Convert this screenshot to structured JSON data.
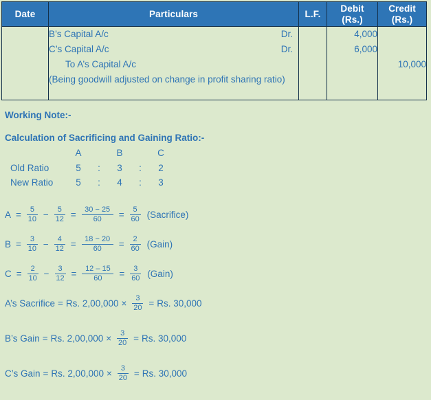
{
  "colors": {
    "page_background": "#dce9cd",
    "header_fill": "#2e75b6",
    "header_text": "#ffffff",
    "body_text": "#2e74b5",
    "border": "#13304a"
  },
  "journal": {
    "headers": {
      "date": "Date",
      "particulars": "Particulars",
      "lf": "L.F.",
      "debit_line1": "Debit",
      "debit_line2": "(Rs.)",
      "credit_line1": "Credit",
      "credit_line2": "(Rs.)"
    },
    "entry": {
      "date": "",
      "lf": "",
      "lines": [
        {
          "particulars": "B’s Capital A/c",
          "dr_tag": "Dr.",
          "debit": "4,000",
          "credit": ""
        },
        {
          "particulars": "C’s Capital A/c",
          "dr_tag": "Dr.",
          "debit": "6,000",
          "credit": ""
        },
        {
          "particulars": "To A’s Capital A/c",
          "dr_tag": "",
          "debit": "",
          "credit": "10,000"
        }
      ],
      "narration": "(Being goodwill adjusted on change in profit sharing ratio)"
    }
  },
  "working_note": {
    "title": "Working Note:-",
    "calc_title": "Calculation of Sacrificing and Gaining Ratio:-",
    "ratio_table": {
      "partner_headers": [
        "A",
        "B",
        "C"
      ],
      "separator": ":",
      "rows": [
        {
          "label": "Old Ratio",
          "values": [
            "5",
            "3",
            "2"
          ]
        },
        {
          "label": "New Ratio",
          "values": [
            "5",
            "4",
            "3"
          ]
        }
      ]
    },
    "fraction_equations": [
      {
        "partner": "A",
        "eq_sign": "=",
        "f1": {
          "num": "5",
          "den": "10"
        },
        "minus": "−",
        "f2": {
          "num": "5",
          "den": "12"
        },
        "eq2": "=",
        "f3": {
          "num": "30 − 25",
          "den": "60"
        },
        "eq3": "=",
        "f4": {
          "num": "5",
          "den": "60"
        },
        "result_label": "(Sacrifice)"
      },
      {
        "partner": "B",
        "eq_sign": "=",
        "f1": {
          "num": "3",
          "den": "10"
        },
        "minus": "−",
        "f2": {
          "num": "4",
          "den": "12"
        },
        "eq2": "=",
        "f3": {
          "num": "18 − 20",
          "den": "60"
        },
        "eq3": "=",
        "f4": {
          "num": "2",
          "den": "60"
        },
        "result_label": "(Gain)"
      },
      {
        "partner": "C",
        "eq_sign": "=",
        "f1": {
          "num": "2",
          "den": "10"
        },
        "minus": "−",
        "f2": {
          "num": "3",
          "den": "12"
        },
        "eq2": "=",
        "f3": {
          "num": "12 – 15",
          "den": "60"
        },
        "eq3": "=",
        "f4": {
          "num": "3",
          "den": "60"
        },
        "result_label": "(Gain)"
      }
    ],
    "money_equations": [
      {
        "label": "A’s Sacrifice",
        "eq_sign": "=",
        "amount": "Rs. 2,00,000",
        "times": "×",
        "frac": {
          "num": "3",
          "den": "20"
        },
        "eq2": "=",
        "result": "Rs. 30,000"
      },
      {
        "label": "B’s Gain",
        "eq_sign": "=",
        "amount": "Rs. 2,00,000",
        "times": "×",
        "frac": {
          "num": "3",
          "den": "20"
        },
        "eq2": "=",
        "result": "Rs. 30,000"
      },
      {
        "label": "C’s Gain",
        "eq_sign": "=",
        "amount": "Rs. 2,00,000",
        "times": "×",
        "frac": {
          "num": "3",
          "den": "20"
        },
        "eq2": "=",
        "result": "Rs. 30,000"
      }
    ]
  }
}
